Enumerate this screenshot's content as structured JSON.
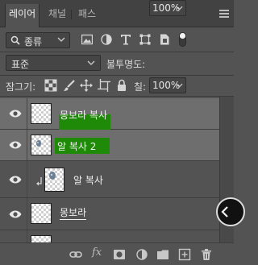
{
  "tabs": [
    {
      "label": "레이어",
      "active": true
    },
    {
      "label": "채널",
      "active": false
    },
    {
      "label": "패스",
      "active": false
    }
  ],
  "filter": {
    "kind_label": "종류",
    "icons": [
      "image-filter-icon",
      "adjustment-filter-icon",
      "type-filter-icon",
      "shape-filter-icon",
      "smart-object-filter-icon",
      "filter-toggle-icon"
    ]
  },
  "blend": {
    "mode": "표준",
    "opacity_label": "불투명도:",
    "opacity_value": "100%"
  },
  "lock": {
    "label": "잠그기:",
    "fill_label": "칠:",
    "fill_value": "100%",
    "icons": [
      "lock-transparent-pixels-icon",
      "lock-image-pixels-icon",
      "lock-position-icon",
      "lock-artboard-icon",
      "lock-all-icon"
    ]
  },
  "layers": [
    {
      "name": "몽보라 복사",
      "selected": true,
      "visible": true,
      "highlight": "#1f8a08"
    },
    {
      "name": "알 복사 2",
      "selected": true,
      "visible": true,
      "highlight": "#1f8a08"
    },
    {
      "name": "알 복사",
      "selected": false,
      "visible": true,
      "clipped": true
    },
    {
      "name": "몽보라",
      "selected": false,
      "visible": true,
      "underline": true
    },
    {
      "name": "",
      "selected": false,
      "visible": true
    }
  ],
  "bottom_icons": [
    "link-layers-icon",
    "fx-icon",
    "add-mask-icon",
    "adjustment-layer-icon",
    "new-group-icon",
    "new-layer-icon",
    "delete-layer-icon"
  ],
  "colors": {
    "panel_bg": "#535353",
    "tabbar_bg": "#424242",
    "selected_row": "#6e6e6e",
    "highlight_green": "#1f8a08"
  }
}
